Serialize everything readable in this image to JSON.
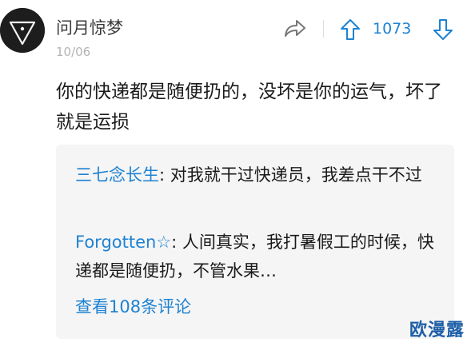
{
  "comment": {
    "username": "问月惊梦",
    "date": "10/06",
    "vote_count": "1073",
    "text": "你的快递都是随便扔的，没坏是你的运气，坏了就是运损"
  },
  "replies": [
    {
      "author": "三七念长生",
      "separator": ":",
      "text": "对我就干过快递员，我差点干不过"
    },
    {
      "author": "Forgotten☆",
      "separator": ":",
      "text": "人间真实，我打暑假工的时候，快递都是随便扔，不管水果…"
    }
  ],
  "view_more": "查看108条评论",
  "watermark": "欧漫露",
  "icons": {
    "avatar": "triangle-logo-icon",
    "share": "share-icon",
    "upvote": "arrow-up-icon",
    "downvote": "arrow-down-icon"
  },
  "colors": {
    "accent": "#1e82d2",
    "reply_bg": "#f5f5f5",
    "watermark": "#1e5fa8"
  }
}
